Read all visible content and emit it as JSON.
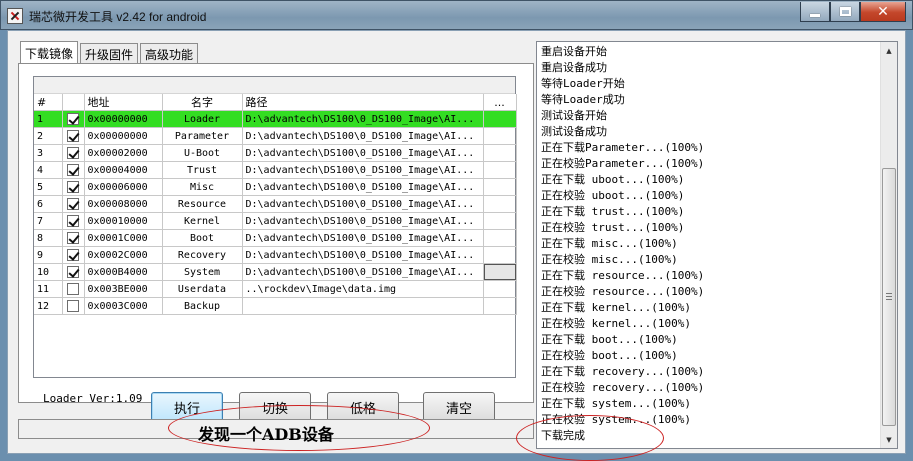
{
  "window": {
    "title": "瑞芯微开发工具 v2.42 for android"
  },
  "tabs": [
    {
      "label": "下载镜像",
      "active": true
    },
    {
      "label": "升级固件",
      "active": false
    },
    {
      "label": "高级功能",
      "active": false
    }
  ],
  "table": {
    "columns": [
      "#",
      "",
      "地址",
      "名字",
      "路径",
      "..."
    ],
    "rows": [
      {
        "n": "1",
        "checked": true,
        "address": "0x00000000",
        "name": "Loader",
        "path": "D:\\advantech\\DS100\\0_DS100_Image\\AI...",
        "highlight": true
      },
      {
        "n": "2",
        "checked": true,
        "address": "0x00000000",
        "name": "Parameter",
        "path": "D:\\advantech\\DS100\\0_DS100_Image\\AI..."
      },
      {
        "n": "3",
        "checked": true,
        "address": "0x00002000",
        "name": "U-Boot",
        "path": "D:\\advantech\\DS100\\0_DS100_Image\\AI..."
      },
      {
        "n": "4",
        "checked": true,
        "address": "0x00004000",
        "name": "Trust",
        "path": "D:\\advantech\\DS100\\0_DS100_Image\\AI..."
      },
      {
        "n": "5",
        "checked": true,
        "address": "0x00006000",
        "name": "Misc",
        "path": "D:\\advantech\\DS100\\0_DS100_Image\\AI..."
      },
      {
        "n": "6",
        "checked": true,
        "address": "0x00008000",
        "name": "Resource",
        "path": "D:\\advantech\\DS100\\0_DS100_Image\\AI..."
      },
      {
        "n": "7",
        "checked": true,
        "address": "0x00010000",
        "name": "Kernel",
        "path": "D:\\advantech\\DS100\\0_DS100_Image\\AI..."
      },
      {
        "n": "8",
        "checked": true,
        "address": "0x0001C000",
        "name": "Boot",
        "path": "D:\\advantech\\DS100\\0_DS100_Image\\AI..."
      },
      {
        "n": "9",
        "checked": true,
        "address": "0x0002C000",
        "name": "Recovery",
        "path": "D:\\advantech\\DS100\\0_DS100_Image\\AI..."
      },
      {
        "n": "10",
        "checked": true,
        "address": "0x000B4000",
        "name": "System",
        "path": "D:\\advantech\\DS100\\0_DS100_Image\\AI...",
        "selected_extra": true
      },
      {
        "n": "11",
        "checked": false,
        "address": "0x003BE000",
        "name": "Userdata",
        "path": "..\\rockdev\\Image\\data.img"
      },
      {
        "n": "12",
        "checked": false,
        "address": "0x0003C000",
        "name": "Backup",
        "path": ""
      }
    ]
  },
  "loader_version": "Loader Ver:1.09",
  "buttons": {
    "run": "执行",
    "switch": "切换",
    "lowformat": "低格",
    "clear": "清空"
  },
  "status": {
    "message": "发现一个ADB设备"
  },
  "log": [
    "重启设备开始",
    "重启设备成功",
    "等待Loader开始",
    "等待Loader成功",
    "测试设备开始",
    "测试设备成功",
    "正在下载Parameter...(100%)",
    "正在校验Parameter...(100%)",
    "正在下载 uboot...(100%)",
    "正在校验 uboot...(100%)",
    "正在下载 trust...(100%)",
    "正在校验 trust...(100%)",
    "正在下载 misc...(100%)",
    "正在校验 misc...(100%)",
    "正在下载 resource...(100%)",
    "正在校验 resource...(100%)",
    "正在下载 kernel...(100%)",
    "正在校验 kernel...(100%)",
    "正在下载 boot...(100%)",
    "正在校验 boot...(100%)",
    "正在下载 recovery...(100%)",
    "正在校验 recovery...(100%)",
    "正在下载 system...(100%)",
    "正在校验 system...(100%)",
    "下载完成"
  ],
  "colors": {
    "highlight_row": "#33dd22",
    "annotation": "#cc2222"
  }
}
